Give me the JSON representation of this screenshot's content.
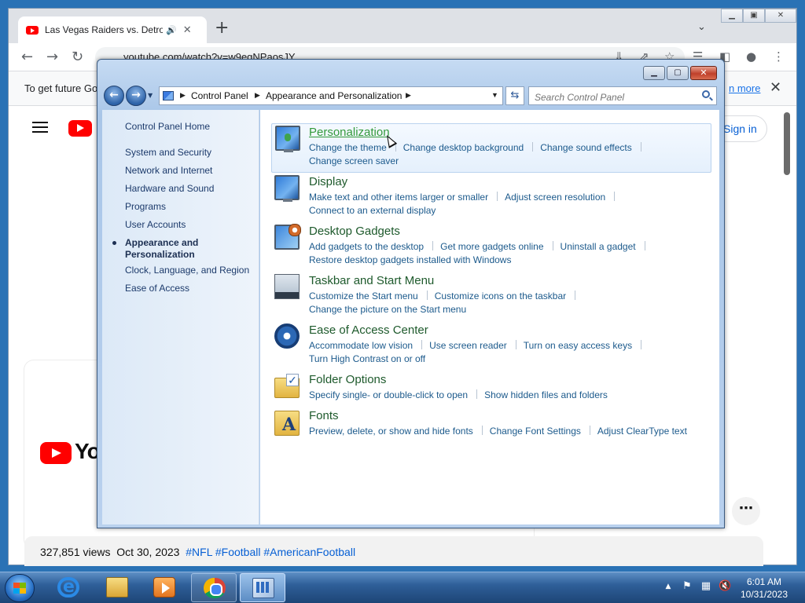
{
  "browser": {
    "tab_title": "Las Vegas Raiders vs. Detroit",
    "tab_audio_icon": "speaker-icon",
    "tab_close": "✕",
    "new_tab": "+",
    "tab_search": "⌄",
    "url": "youtube.com/watch?v=w9egNPaosJY",
    "infobar_text": "To get future Go",
    "infobar_link": "n more",
    "infobar_close": "✕",
    "signin_label": "Sign in",
    "player_logo_text": "You",
    "more_button": "⋯",
    "video_meta": {
      "views": "327,851 views",
      "date": "Oct 30, 2023",
      "tags": "#NFL #Football #AmericanFootball"
    }
  },
  "control_panel": {
    "breadcrumb": [
      "Control Panel",
      "Appearance and Personalization"
    ],
    "search_placeholder": "Search Control Panel",
    "left_nav": {
      "home": "Control Panel Home",
      "items": [
        "System and Security",
        "Network and Internet",
        "Hardware and Sound",
        "Programs",
        "User Accounts",
        "Appearance and\nPersonalization",
        "Clock, Language, and Region",
        "Ease of Access"
      ],
      "current_item": "Appearance and Personalization"
    },
    "categories": [
      {
        "title": "Personalization",
        "icon": "personalization-icon",
        "links": [
          "Change the theme",
          "Change desktop background",
          "Change sound effects",
          "Change screen saver"
        ]
      },
      {
        "title": "Display",
        "icon": "display-icon",
        "links": [
          "Make text and other items larger or smaller",
          "Adjust screen resolution",
          "Connect to an external display"
        ]
      },
      {
        "title": "Desktop Gadgets",
        "icon": "gadgets-icon",
        "links": [
          "Add gadgets to the desktop",
          "Get more gadgets online",
          "Uninstall a gadget",
          "Restore desktop gadgets installed with Windows"
        ]
      },
      {
        "title": "Taskbar and Start Menu",
        "icon": "taskbar-icon",
        "links": [
          "Customize the Start menu",
          "Customize icons on the taskbar",
          "Change the picture on the Start menu"
        ]
      },
      {
        "title": "Ease of Access Center",
        "icon": "ease-of-access-icon",
        "links": [
          "Accommodate low vision",
          "Use screen reader",
          "Turn on easy access keys",
          "Turn High Contrast on or off"
        ]
      },
      {
        "title": "Folder Options",
        "icon": "folder-options-icon",
        "links": [
          "Specify single- or double-click to open",
          "Show hidden files and folders"
        ]
      },
      {
        "title": "Fonts",
        "icon": "fonts-icon",
        "links": [
          "Preview, delete, or show and hide fonts",
          "Change Font Settings",
          "Adjust ClearType text"
        ]
      }
    ]
  },
  "taskbar": {
    "apps": [
      "internet-explorer-icon",
      "windows-explorer-icon",
      "media-player-icon",
      "chrome-icon",
      "control-panel-icon"
    ],
    "time": "6:01 AM",
    "date": "10/31/2023"
  },
  "colors": {
    "category_title": "#1e5a2c",
    "category_title_hover": "#339a3a",
    "task_link": "#1c5a8c",
    "taskbar": "#2f5f99"
  }
}
